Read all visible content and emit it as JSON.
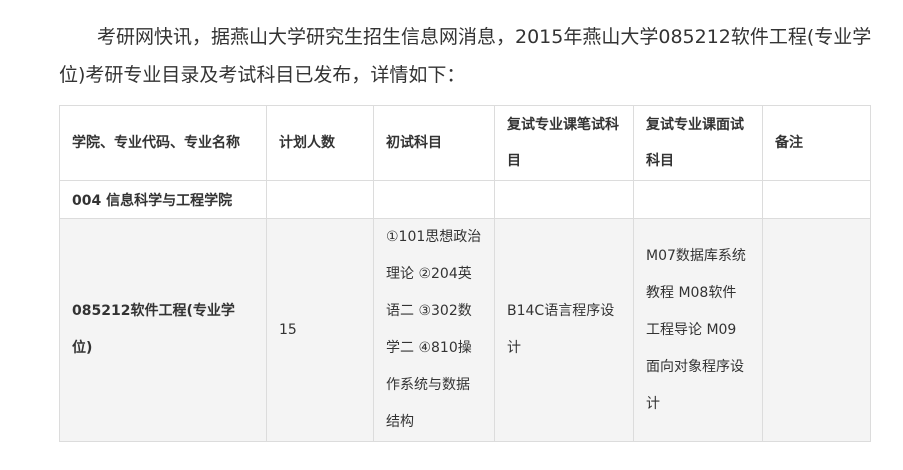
{
  "intro": "考研网快讯，据燕山大学研究生招生信息网消息，2015年燕山大学085212软件工程(专业学位)考研专业目录及考试科目已发布，详情如下：",
  "table": {
    "headers": {
      "college": "学院、专业代码、专业名称",
      "plan": "计划人数",
      "initial": "初试科目",
      "written": "复试专业课笔试科目",
      "interview": "复试专业课面试科目",
      "note": "备注"
    },
    "school_row": {
      "name": "004 信息科学与工程学院"
    },
    "major_row": {
      "name": "085212软件工程(专业学位)",
      "plan": "15",
      "initial": "①101思想政治理论 ②204英语二 ③302数学二 ④810操作系统与数据结构",
      "written": "B14C语言程序设计",
      "interview": "M07数据库系统教程 M08软件工程导论 M09面向对象程序设计",
      "note": ""
    }
  }
}
